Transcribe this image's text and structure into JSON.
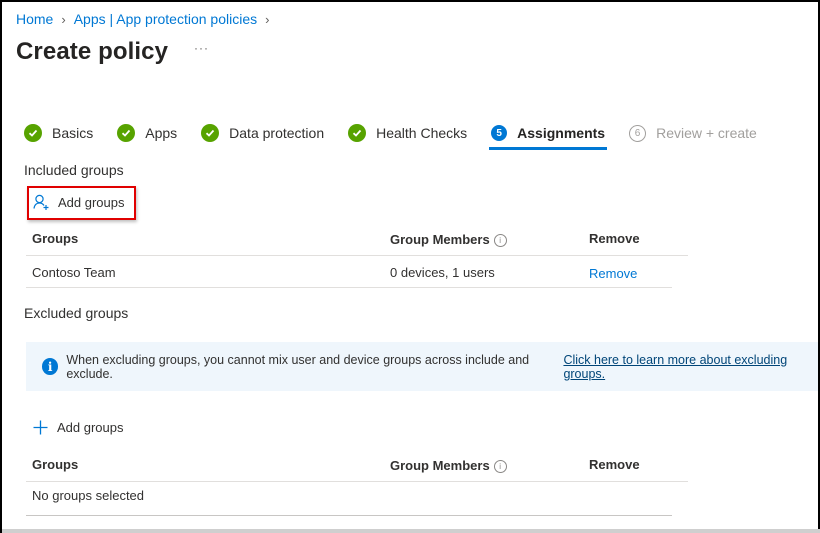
{
  "breadcrumb": [
    {
      "label": "Home"
    },
    {
      "label": "Apps | App protection policies"
    }
  ],
  "page": {
    "title": "Create policy",
    "more_label": "···"
  },
  "steps": [
    {
      "label": "Basics",
      "state": "done"
    },
    {
      "label": "Apps",
      "state": "done"
    },
    {
      "label": "Data protection",
      "state": "done"
    },
    {
      "label": "Health Checks",
      "state": "done"
    },
    {
      "label": "Assignments",
      "state": "current",
      "number": "5"
    },
    {
      "label": "Review + create",
      "state": "pending",
      "number": "6"
    }
  ],
  "included": {
    "section_label": "Included groups",
    "add_label": "Add groups",
    "columns": [
      "Groups",
      "Group Members",
      "Remove"
    ],
    "rows": [
      {
        "group": "Contoso Team",
        "members": "0 devices, 1 users",
        "action": "Remove"
      }
    ]
  },
  "excluded": {
    "section_label": "Excluded groups",
    "banner_text": "When excluding groups, you cannot mix user and device groups across include and exclude.",
    "banner_link": "Click here to learn more about excluding groups.",
    "add_label": "Add groups",
    "columns": [
      "Groups",
      "Group Members",
      "Remove"
    ],
    "empty_text": "No groups selected"
  },
  "colors": {
    "accent": "#0078d4",
    "success": "#57a300",
    "highlight_box": "#e00000",
    "banner_bg": "#eff6fc"
  }
}
